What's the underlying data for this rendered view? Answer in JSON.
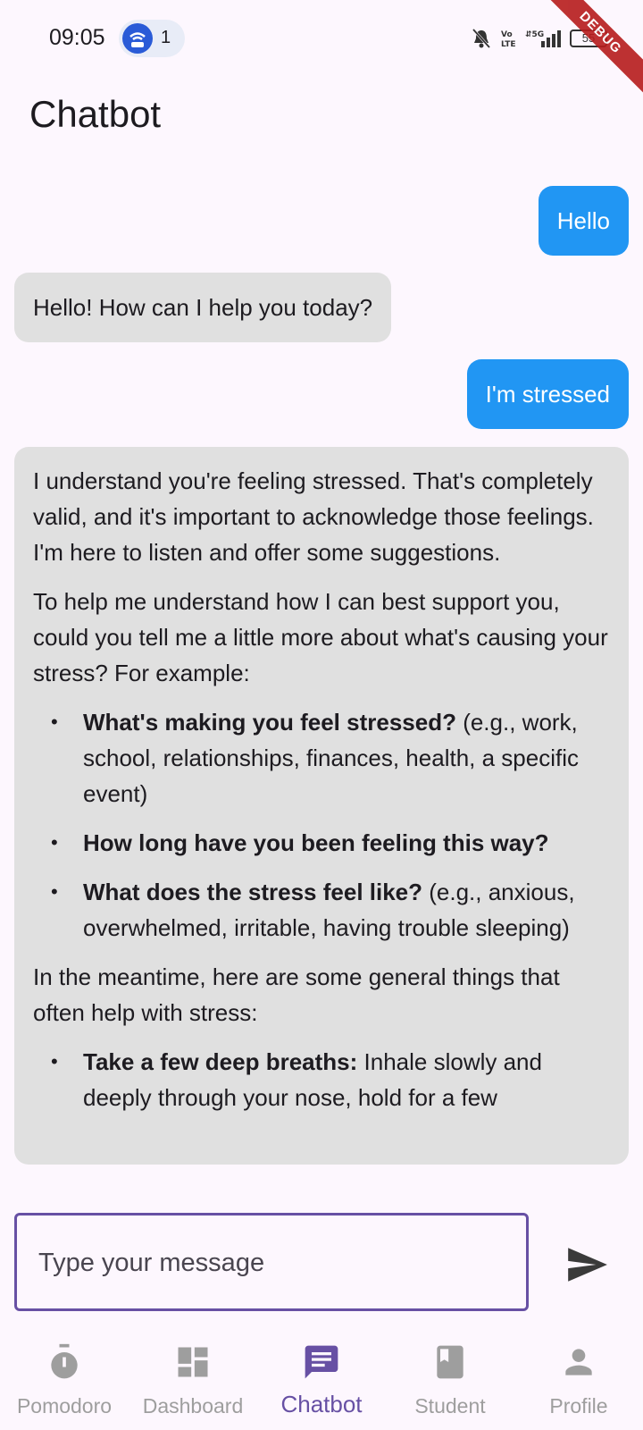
{
  "status_bar": {
    "time": "09:05",
    "notification_count": "1",
    "battery": "55",
    "debug_banner": "DEBUG"
  },
  "header": {
    "title": "Chatbot"
  },
  "messages": [
    {
      "sender": "user",
      "text": "Hello"
    },
    {
      "sender": "bot",
      "text": "Hello! How can I help you today?"
    },
    {
      "sender": "user",
      "text": "I'm stressed"
    },
    {
      "sender": "bot",
      "para1": "I understand you're feeling stressed. That's completely valid, and it's important to acknowledge those feelings. I'm here to listen and offer some suggestions.",
      "para2": "To help me understand how I can best support you, could you tell me a little more about what's causing your stress? For example:",
      "list1": [
        {
          "bold": "What's making you feel stressed?",
          "rest": " (e.g., work, school, relationships, finances, health, a specific event)"
        },
        {
          "bold": "How long have you been feeling this way?",
          "rest": ""
        },
        {
          "bold": "What does the stress feel like?",
          "rest": " (e.g., anxious, overwhelmed, irritable, having trouble sleeping)"
        }
      ],
      "para3": "In the meantime, here are some general things that often help with stress:",
      "list2": [
        {
          "bold": "Take a few deep breaths:",
          "rest": " Inhale slowly and deeply through your nose, hold for a few"
        }
      ]
    }
  ],
  "input": {
    "placeholder": "Type your message"
  },
  "nav": [
    {
      "label": "Pomodoro",
      "icon": "timer-icon"
    },
    {
      "label": "Dashboard",
      "icon": "dashboard-icon"
    },
    {
      "label": "Chatbot",
      "icon": "chat-icon",
      "active": true
    },
    {
      "label": "Student",
      "icon": "book-icon"
    },
    {
      "label": "Profile",
      "icon": "person-icon"
    }
  ],
  "colors": {
    "background": "#fdf7fe",
    "user_bubble": "#2196f3",
    "bot_bubble": "#e0e0e0",
    "accent": "#6750a4",
    "inactive_nav": "#9e9e9e"
  }
}
